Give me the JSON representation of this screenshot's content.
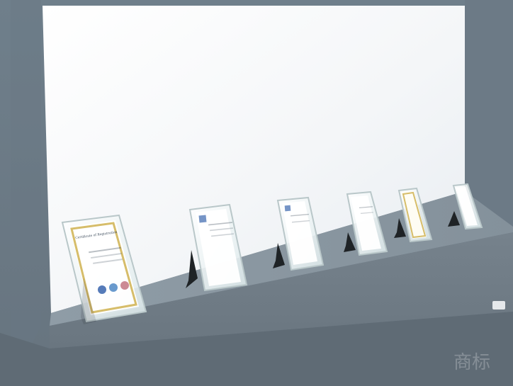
{
  "scene": {
    "type": "photo",
    "colors": {
      "frame_gray": "#6f7f8b",
      "wall_white": "#f4f6f8",
      "shelf_top": "#8a97a1",
      "shelf_front": "#707c86",
      "floor": "#5e6a74",
      "glass": "#e9f2f2",
      "stand": "#1f2326",
      "gold": "#d6bd6a"
    },
    "certificates": [
      {
        "id": "cert-1",
        "title": "Certificate of Registration",
        "style": "gold"
      },
      {
        "id": "cert-2",
        "title": "",
        "style": "blue"
      },
      {
        "id": "cert-3",
        "title": "",
        "style": "blue"
      },
      {
        "id": "cert-4",
        "title": "",
        "style": "blue"
      },
      {
        "id": "cert-5",
        "title": "",
        "style": "gold"
      },
      {
        "id": "cert-6",
        "title": "",
        "style": "blue"
      }
    ],
    "watermark": {
      "text": "商标"
    }
  }
}
